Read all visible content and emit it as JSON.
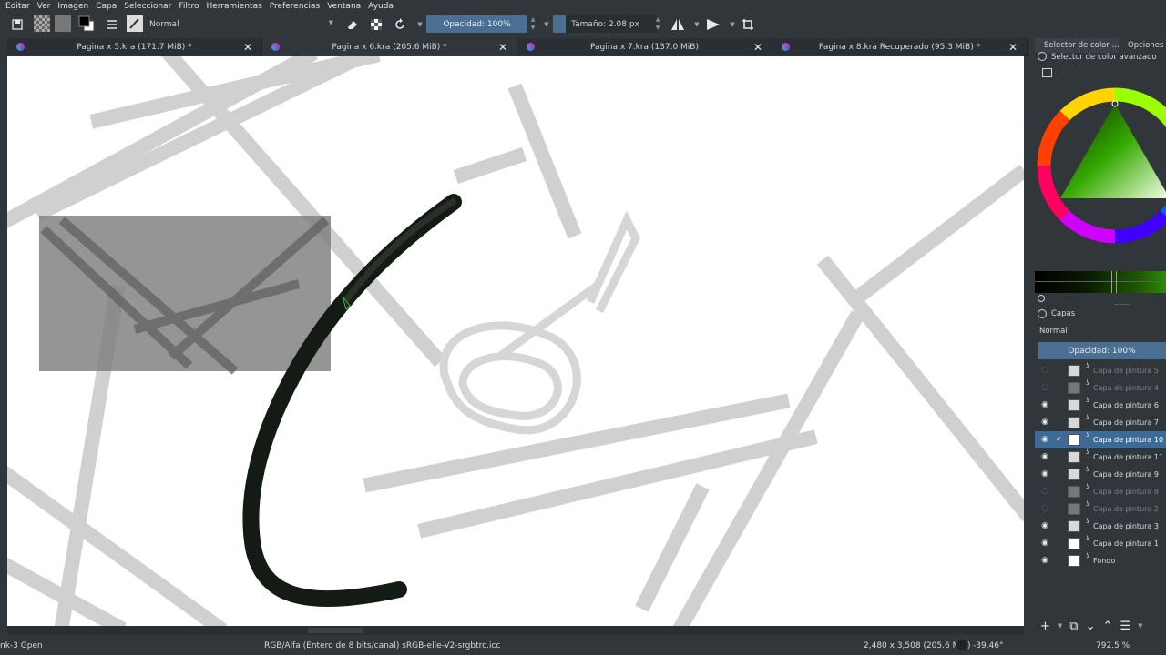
{
  "menu": [
    "Editar",
    "Ver",
    "Imagen",
    "Capa",
    "Seleccionar",
    "Filtro",
    "Herramientas",
    "Preferencias",
    "Ventana",
    "Ayuda"
  ],
  "toolbar": {
    "blend_mode": "Normal",
    "opacity_label": "Opacidad: 100%",
    "size_label": "Tamaño: 2.08 px"
  },
  "tabs": [
    {
      "title": "Pagina x 5.kra (171.7 MiB) *",
      "active": false
    },
    {
      "title": "Pagina x 6.kra (205.6 MiB) *",
      "active": true
    },
    {
      "title": "Pagina x 7.kra (137.0 MiB)",
      "active": false
    },
    {
      "title": "Pagina x 8.kra Recuperado (95.3 MiB) *",
      "active": false
    }
  ],
  "docker": {
    "tabs": [
      "Selector de color ...",
      "Opciones de"
    ],
    "color_selector_title": "Selector de color avanzado",
    "layers_title": "Capas",
    "blend_mode": "Normal",
    "opacity_label": "Opacidad:  100%"
  },
  "layers": [
    {
      "name": "Capa de pintura 5",
      "visible": false,
      "selected": false,
      "thumb": "line"
    },
    {
      "name": "Capa de pintura 4",
      "visible": false,
      "selected": false,
      "thumb": "gray"
    },
    {
      "name": "Capa de pintura 6",
      "visible": true,
      "selected": false,
      "thumb": "light"
    },
    {
      "name": "Capa de pintura 7",
      "visible": true,
      "selected": false,
      "thumb": "light"
    },
    {
      "name": "Capa de pintura 10",
      "visible": true,
      "selected": true,
      "thumb": "white"
    },
    {
      "name": "Capa de pintura 11",
      "visible": true,
      "selected": false,
      "thumb": "light"
    },
    {
      "name": "Capa de pintura 9",
      "visible": true,
      "selected": false,
      "thumb": "light"
    },
    {
      "name": "Capa de pintura 8",
      "visible": false,
      "selected": false,
      "thumb": "gray"
    },
    {
      "name": "Capa de pintura 2",
      "visible": false,
      "selected": false,
      "thumb": "gray"
    },
    {
      "name": "Capa de pintura 3",
      "visible": true,
      "selected": false,
      "thumb": "light"
    },
    {
      "name": "Capa de pintura 1",
      "visible": true,
      "selected": false,
      "thumb": "white"
    },
    {
      "name": "Fondo",
      "visible": true,
      "selected": false,
      "thumb": "white"
    }
  ],
  "status": {
    "brush": "nk-3 Gpen",
    "color_space": "RGB/Alfa (Entero de 8 bits/canal)  sRGB-elle-V2-srgbtrc.icc",
    "dimensions": "2,480 x 3,508 (205.6 MiB)",
    "rotation": "-39.46°",
    "zoom": "792.5 %"
  },
  "colors": {
    "accent": "#4a6f93",
    "selected_row": "#3d6b96",
    "panel": "#31363b",
    "canvas": "#ffffff"
  }
}
